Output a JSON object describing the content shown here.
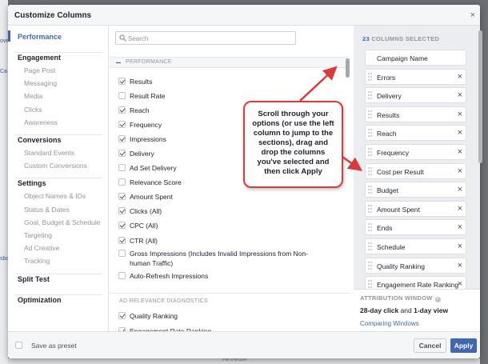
{
  "modal": {
    "title": "Customize Columns",
    "close": "×"
  },
  "background": {
    "fragments": [
      "ove",
      "Ca",
      "sbo"
    ],
    "bottom_text": "Per Person"
  },
  "nav": {
    "groups": [
      {
        "label": "Performance",
        "items": []
      },
      {
        "label": "Engagement",
        "items": [
          "Page Post",
          "Messaging",
          "Media",
          "Clicks",
          "Awareness"
        ]
      },
      {
        "label": "Conversions",
        "items": [
          "Standard Events",
          "Custom Conversions"
        ]
      },
      {
        "label": "Settings",
        "items": [
          "Object Names & IDs",
          "Status & Dates",
          "Goal, Budget & Schedule",
          "Targeting",
          "Ad Creative",
          "Tracking"
        ]
      },
      {
        "label": "Split Test",
        "items": []
      },
      {
        "label": "Optimization",
        "items": []
      }
    ]
  },
  "search": {
    "placeholder": "Search",
    "value": ""
  },
  "sections": {
    "performance": "PERFORMANCE",
    "ad_relevance": "AD RELEVANCE DIAGNOSTICS"
  },
  "options": [
    {
      "label": "Results",
      "checked": true
    },
    {
      "label": "Result Rate",
      "checked": false
    },
    {
      "label": "Reach",
      "checked": true
    },
    {
      "label": "Frequency",
      "checked": true
    },
    {
      "label": "Impressions",
      "checked": true
    },
    {
      "label": "Delivery",
      "checked": true
    },
    {
      "label": "Ad Set Delivery",
      "checked": false
    },
    {
      "label": "Relevance Score",
      "checked": false
    },
    {
      "label": "Amount Spent",
      "checked": true
    },
    {
      "label": "Clicks (All)",
      "checked": true
    },
    {
      "label": "CPC (All)",
      "checked": true
    },
    {
      "label": "CTR (All)",
      "checked": true
    },
    {
      "label": "Gross Impressions (Includes Invalid Impressions from Non-human Traffic)",
      "checked": false
    },
    {
      "label": "Auto-Refresh Impressions",
      "checked": false
    }
  ],
  "relevance_options": [
    {
      "label": "Quality Ranking",
      "checked": true
    },
    {
      "label": "Engagement Rate Ranking",
      "checked": true
    }
  ],
  "selected": {
    "count": "23",
    "label": "COLUMNS SELECTED",
    "columns": [
      {
        "name": "Campaign Name",
        "removable": false
      },
      {
        "name": "Errors",
        "removable": true
      },
      {
        "name": "Delivery",
        "removable": true
      },
      {
        "name": "Results",
        "removable": true
      },
      {
        "name": "Reach",
        "removable": true
      },
      {
        "name": "Frequency",
        "removable": true
      },
      {
        "name": "Cost per Result",
        "removable": true
      },
      {
        "name": "Budget",
        "removable": true
      },
      {
        "name": "Amount Spent",
        "removable": true
      },
      {
        "name": "Ends",
        "removable": true
      },
      {
        "name": "Schedule",
        "removable": true
      },
      {
        "name": "Quality Ranking",
        "removable": true
      },
      {
        "name": "Engagement Rate Ranking",
        "removable": true
      }
    ]
  },
  "attribution": {
    "title": "ATTRIBUTION WINDOW",
    "info_icon": "i",
    "bold1": "28-day click",
    "mid": " and ",
    "bold2": "1-day view",
    "link": "Comparing Windows"
  },
  "footer": {
    "preset_label": "Save as preset",
    "cancel": "Cancel",
    "apply": "Apply"
  },
  "annotation": {
    "text": "Scroll through your options (or use the left column to jump to the sections), drag and drop the columns you've selected and then click Apply"
  },
  "colors": {
    "accent": "#4267b2",
    "annotation": "#d93b3b"
  }
}
